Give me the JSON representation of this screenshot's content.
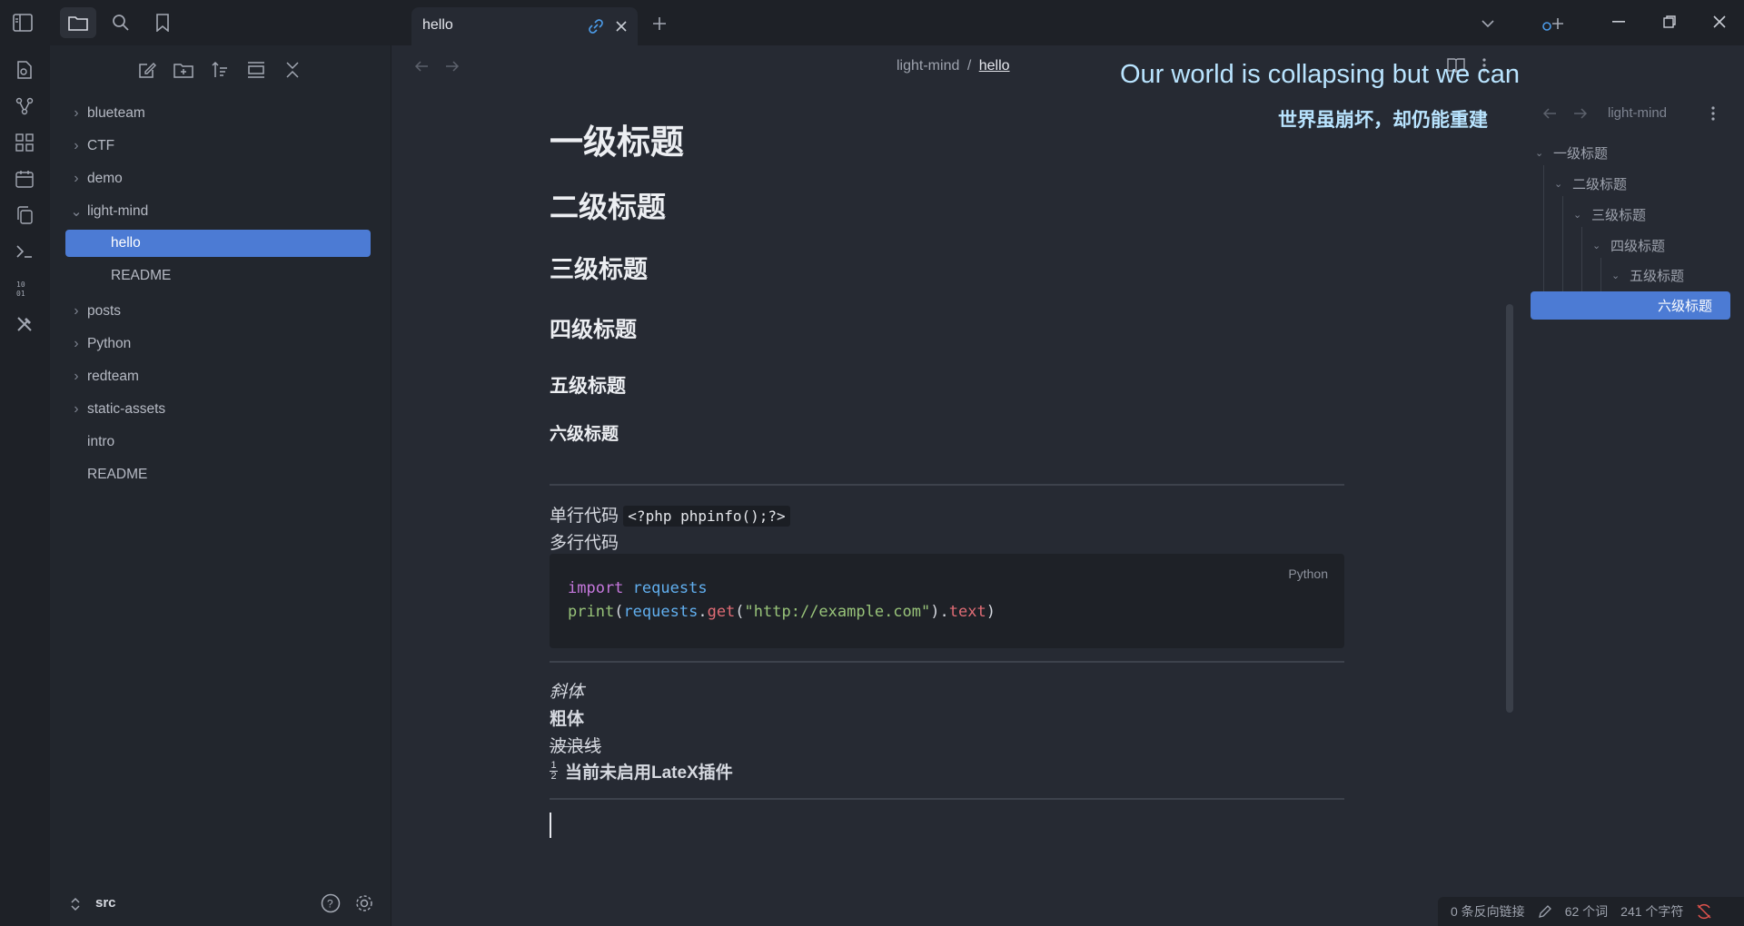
{
  "tab": {
    "title": "hello"
  },
  "sidebar": {
    "items": [
      {
        "label": "blueteam",
        "folder": true
      },
      {
        "label": "CTF",
        "folder": true
      },
      {
        "label": "demo",
        "folder": true
      },
      {
        "label": "light-mind",
        "folder": true,
        "open": true
      },
      {
        "label": "hello",
        "active": true
      },
      {
        "label": "README"
      },
      {
        "label": "posts",
        "folder": true
      },
      {
        "label": "Python",
        "folder": true
      },
      {
        "label": "redteam",
        "folder": true
      },
      {
        "label": "static-assets",
        "folder": true
      },
      {
        "label": "intro"
      },
      {
        "label": "README"
      }
    ],
    "vault": "src"
  },
  "breadcrumb": {
    "parent": "light-mind",
    "sep": "/",
    "current": "hello"
  },
  "doc": {
    "h1": "一级标题",
    "h2": "二级标题",
    "h3": "三级标题",
    "h4": "四级标题",
    "h5": "五级标题",
    "h6": "六级标题",
    "inline_code_label": "单行代码",
    "inline_code": "<?php phpinfo();?>",
    "multiline_label": "多行代码",
    "code_lang": "Python",
    "code": {
      "l1_kw": "import",
      "l1_mod": "requests",
      "l2_fn": "print",
      "l2_open": "(",
      "l2_mod": "requests",
      "l2_dot1": ".",
      "l2_get": "get",
      "l2_paren": "(",
      "l2_str": "\"http://example.com\"",
      "l2_close": ")",
      "l2_dot2": ".",
      "l2_text": "text",
      "l2_end": ")"
    },
    "italic": "斜体",
    "bold": "粗体",
    "strike": "波浪线",
    "latex_note": "当前未启用LateX插件",
    "fraction_num": "1",
    "fraction_den": "2"
  },
  "overlay": {
    "en": "Our world is collapsing but we can rebuild it",
    "zh": "世界虽崩坏，却仍能重建"
  },
  "outline": {
    "title": "light-mind",
    "items": [
      "一级标题",
      "二级标题",
      "三级标题",
      "四级标题",
      "五级标题"
    ],
    "active": "六级标题"
  },
  "status": {
    "backlinks": "0 条反向链接",
    "words": "62 个词",
    "chars": "241 个字符"
  },
  "colors": {
    "accent": "#4c7bd4",
    "overlay_text": "#b9e4ff"
  }
}
